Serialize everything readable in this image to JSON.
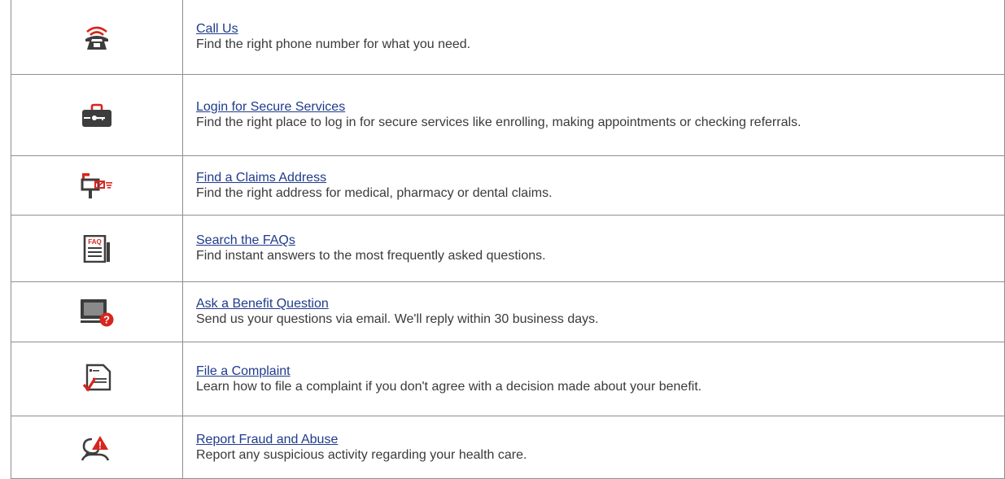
{
  "accent_color": "#d7261e",
  "icon_dark": "#3d3d3d",
  "link_color": "#1f3b8c",
  "rows": [
    {
      "icon": "telephone-icon",
      "link": "Call Us",
      "description": "Find the right phone number for what you need."
    },
    {
      "icon": "briefcase-key-icon",
      "link": "Login for Secure Services",
      "description": "Find the right place to log in for secure services like enrolling, making appointments or checking referrals."
    },
    {
      "icon": "mailbox-icon",
      "link": "Find a Claims Address",
      "description": "Find the right address for medical, pharmacy or dental claims."
    },
    {
      "icon": "faq-document-icon",
      "link": "Search the FAQs",
      "icon_text": "FAQ",
      "description": "Find instant answers to the most frequently asked questions."
    },
    {
      "icon": "monitor-question-icon",
      "link": "Ask a Benefit Question",
      "icon_text": "?",
      "description": "Send us your questions via email. We'll reply within 30 business days."
    },
    {
      "icon": "document-check-icon",
      "link": "File a Complaint",
      "description": "Learn how to file a complaint if you don't agree with a decision made about your benefit."
    },
    {
      "icon": "person-alert-icon",
      "link": "Report Fraud and Abuse",
      "icon_text": "!",
      "description": "Report any suspicious activity regarding your health care."
    }
  ]
}
